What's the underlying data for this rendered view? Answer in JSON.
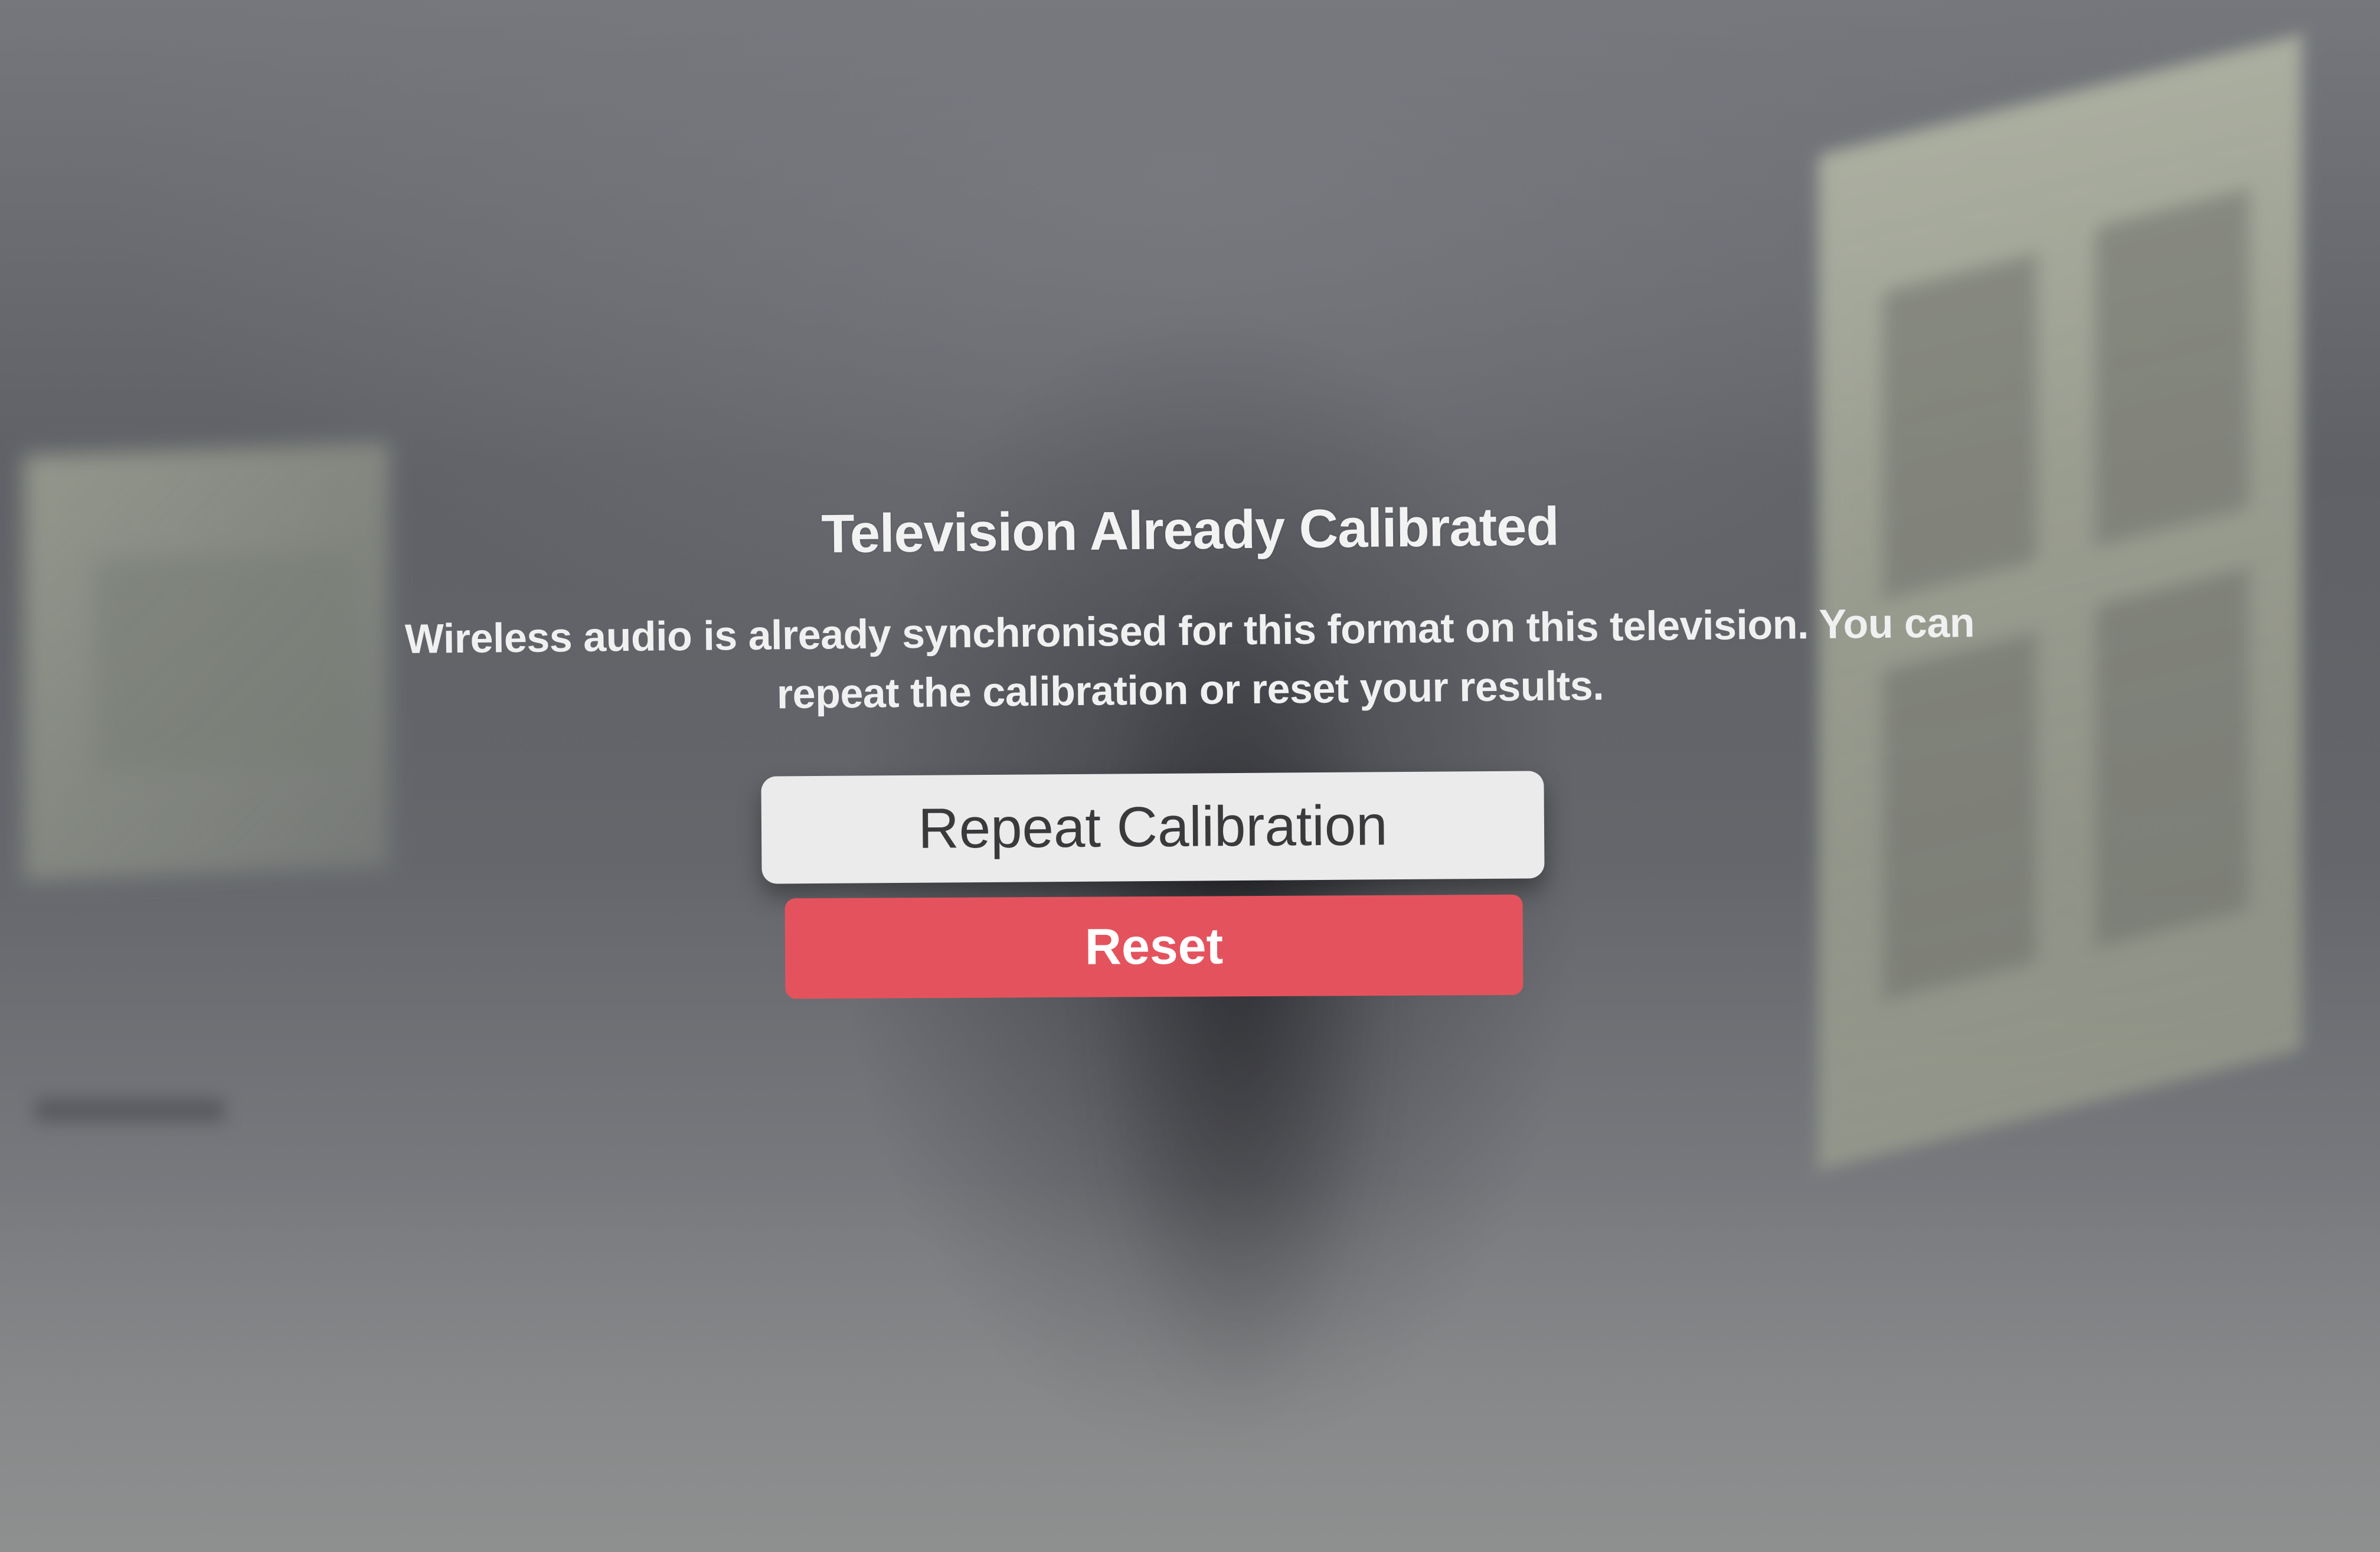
{
  "dialog": {
    "title": "Television Already Calibrated",
    "message": "Wireless audio is already synchronised for this format on this television. You can repeat the calibration or reset your results.",
    "buttons": {
      "repeat_label": "Repeat Calibration",
      "reset_label": "Reset"
    }
  },
  "colors": {
    "reset_button": "#e4535d",
    "repeat_button": "#ebebeb",
    "background": "#6f7176"
  }
}
